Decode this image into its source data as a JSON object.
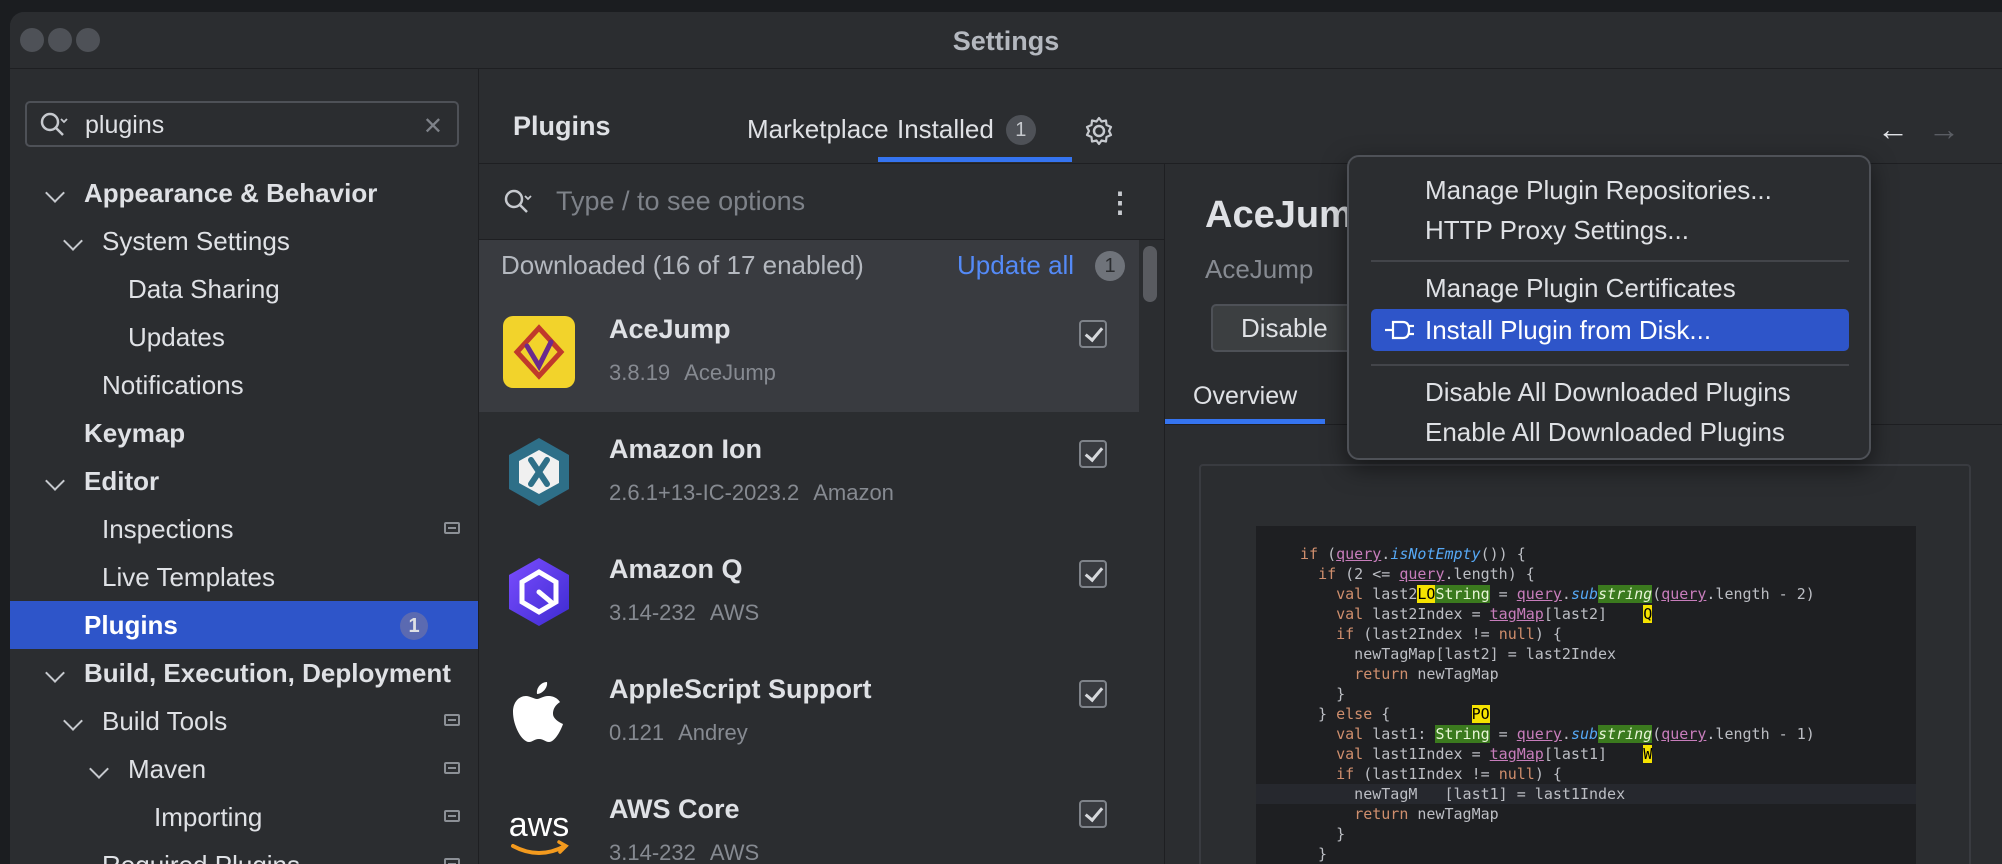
{
  "window": {
    "title": "Settings"
  },
  "sidebar": {
    "search": {
      "value": "plugins",
      "clear_icon": "close-icon"
    },
    "items": [
      {
        "label": "Appearance & Behavior",
        "level": 0,
        "expanded": true,
        "bold": true
      },
      {
        "label": "System Settings",
        "level": 1,
        "expanded": true
      },
      {
        "label": "Data Sharing",
        "level": 2
      },
      {
        "label": "Updates",
        "level": 2
      },
      {
        "label": "Notifications",
        "level": 1
      },
      {
        "label": "Keymap",
        "level": 0,
        "bold": true
      },
      {
        "label": "Editor",
        "level": 0,
        "expanded": true,
        "bold": true
      },
      {
        "label": "Inspections",
        "level": 1,
        "page_icon": true
      },
      {
        "label": "Live Templates",
        "level": 1
      },
      {
        "label": "Plugins",
        "level": 0,
        "bold": true,
        "selected": true,
        "badge": "1"
      },
      {
        "label": "Build, Execution, Deployment",
        "level": 0,
        "expanded": true,
        "bold": true
      },
      {
        "label": "Build Tools",
        "level": 1,
        "expanded": true,
        "page_icon": true
      },
      {
        "label": "Maven",
        "level": 2,
        "expanded": true,
        "page_icon": true
      },
      {
        "label": "Importing",
        "level": 3,
        "page_icon": true
      },
      {
        "label": "Required Plugins",
        "level": 1,
        "page_icon": true
      }
    ]
  },
  "header": {
    "title": "Plugins",
    "tabs": [
      {
        "label": "Marketplace"
      },
      {
        "label": "Installed",
        "badge": "1",
        "active": true
      }
    ],
    "back_glyph": "←",
    "forward_glyph": "→"
  },
  "plugin_list": {
    "search_placeholder": "Type / to see options",
    "kebab_glyph": "⋮",
    "section_title": "Downloaded (16 of 17 enabled)",
    "update_all_label": "Update all",
    "update_badge": "1",
    "plugins": [
      {
        "name": "AceJump",
        "version": "3.8.19",
        "vendor": "AceJump",
        "enabled": true,
        "selected": true,
        "icon": "acejump-logo-icon"
      },
      {
        "name": "Amazon Ion",
        "version": "2.6.1+13-IC-2023.2",
        "vendor": "Amazon",
        "enabled": true,
        "icon": "amazon-ion-logo-icon"
      },
      {
        "name": "Amazon Q",
        "version": "3.14-232",
        "vendor": "AWS",
        "enabled": true,
        "icon": "amazon-q-logo-icon"
      },
      {
        "name": "AppleScript Support",
        "version": "0.121",
        "vendor": "Andrey",
        "enabled": true,
        "icon": "apple-logo-icon"
      },
      {
        "name": "AWS Core",
        "version": "3.14-232",
        "vendor": "AWS",
        "enabled": true,
        "icon": "aws-logo-icon"
      }
    ]
  },
  "detail": {
    "title": "AceJump",
    "vendor": "AceJump",
    "disable_label": "Disable",
    "tab_overview": "Overview"
  },
  "popup_menu": {
    "items": [
      {
        "label": "Manage Plugin Repositories..."
      },
      {
        "label": "HTTP Proxy Settings..."
      },
      {
        "label": "Manage Plugin Certificates"
      },
      {
        "label": "Install Plugin from Disk...",
        "selected": true,
        "icon": "plug-icon"
      },
      {
        "label": "Disable All Downloaded Plugins"
      },
      {
        "label": "Enable All Downloaded Plugins"
      }
    ]
  },
  "colors": {
    "accent": "#3574f0",
    "selection": "#2e55c9",
    "background": "#2b2d30",
    "link": "#548af7"
  }
}
